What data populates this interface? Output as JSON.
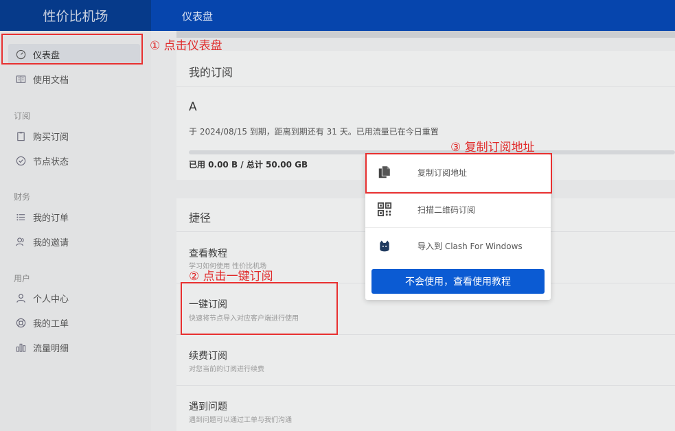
{
  "sidebar": {
    "brand": "性价比机场",
    "items": [
      {
        "label": "仪表盘",
        "icon": "dashboard-icon"
      },
      {
        "label": "使用文档",
        "icon": "book-icon"
      },
      {
        "label": "购买订阅",
        "icon": "clipboard-icon"
      },
      {
        "label": "节点状态",
        "icon": "check-circle-icon"
      },
      {
        "label": "我的订单",
        "icon": "list-icon"
      },
      {
        "label": "我的邀请",
        "icon": "users-icon"
      },
      {
        "label": "个人中心",
        "icon": "user-icon"
      },
      {
        "label": "我的工单",
        "icon": "support-icon"
      },
      {
        "label": "流量明细",
        "icon": "bar-chart-icon"
      }
    ],
    "sections": [
      "订阅",
      "财务",
      "用户"
    ]
  },
  "header": {
    "title": "仪表盘"
  },
  "subscription": {
    "heading": "我的订阅",
    "plan": "A",
    "expiry_text": "于 2024/08/15 到期，距离到期还有 31 天。已用流量已在今日重置",
    "usage_text": "已用 0.00 B / 总计 50.00 GB",
    "usage_fraction": 0
  },
  "shortcuts": {
    "heading": "捷径",
    "items": [
      {
        "title": "查看教程",
        "sub": "学习如何使用 性价比机场"
      },
      {
        "title": "一键订阅",
        "sub": "快速将节点导入对应客户端进行使用"
      },
      {
        "title": "续费订阅",
        "sub": "对您当前的订阅进行续费"
      },
      {
        "title": "遇到问题",
        "sub": "遇到问题可以通过工单与我们沟通"
      }
    ]
  },
  "popup": {
    "items": [
      {
        "label": "复制订阅地址",
        "icon": "copy-icon"
      },
      {
        "label": "扫描二维码订阅",
        "icon": "qrcode-icon"
      },
      {
        "label": "导入到 Clash For Windows",
        "icon": "clash-cat-icon"
      }
    ],
    "button": "不会使用，查看使用教程"
  },
  "annotations": {
    "step1": "① 点击仪表盘",
    "step2": "② 点击一键订阅",
    "step3": "③ 复制订阅地址"
  },
  "colors": {
    "header": "#0645ad",
    "brand_bg": "#063a8a",
    "primary_button": "#0b5bd3",
    "annotation": "#e83030"
  }
}
